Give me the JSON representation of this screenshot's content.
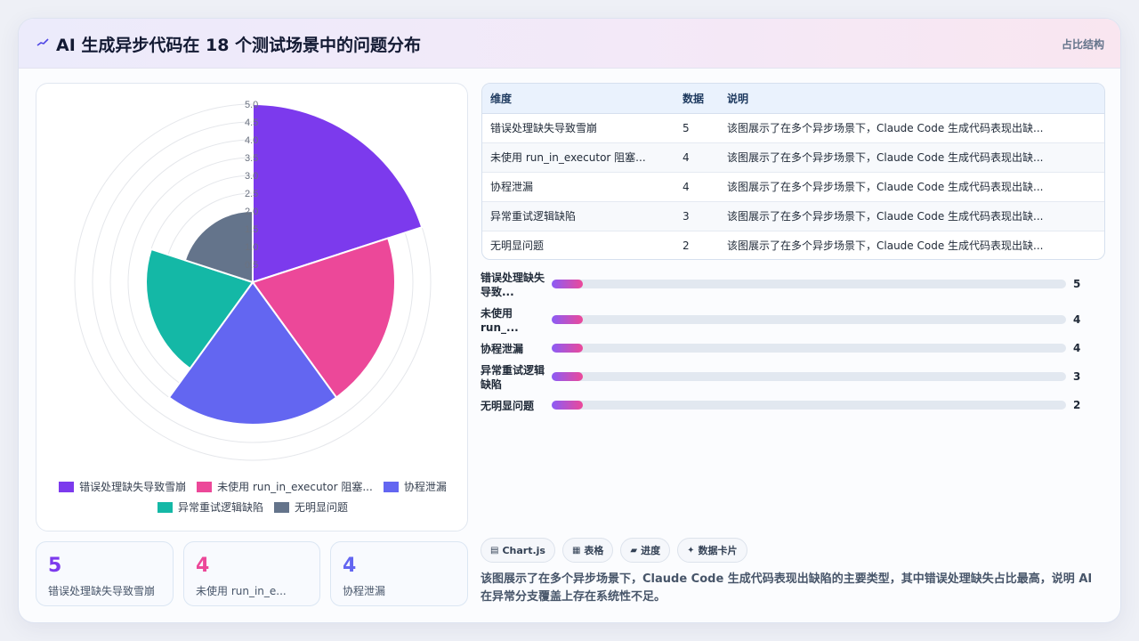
{
  "header": {
    "title": "AI 生成异步代码在 18 个测试场景中的问题分布",
    "subtitle": "占比结构",
    "icon": "trend-line-icon"
  },
  "chart_data": {
    "type": "polarArea",
    "categories": [
      "错误处理缺失导致雪崩",
      "未使用 run_in_executor 阻塞...",
      "协程泄漏",
      "异常重试逻辑缺陷",
      "无明显问题"
    ],
    "values": [
      5,
      4,
      4,
      3,
      2
    ],
    "colors": [
      "#7c3aed",
      "#ec4899",
      "#6366f1",
      "#14b8a6",
      "#64748b"
    ],
    "r_max": 5.0,
    "r_ticks": [
      "5.0",
      "4.5",
      "4.0",
      "3.5",
      "3.0",
      "2.5",
      "2.0",
      "1.5",
      "1.0",
      "0.5"
    ],
    "legend_position": "bottom"
  },
  "table": {
    "headers": [
      "维度",
      "数据",
      "说明"
    ],
    "rows": [
      [
        "错误处理缺失导致雪崩",
        "5",
        "该图展示了在多个异步场景下，Claude Code 生成代码表现出缺..."
      ],
      [
        "未使用 run_in_executor 阻塞...",
        "4",
        "该图展示了在多个异步场景下，Claude Code 生成代码表现出缺..."
      ],
      [
        "协程泄漏",
        "4",
        "该图展示了在多个异步场景下，Claude Code 生成代码表现出缺..."
      ],
      [
        "异常重试逻辑缺陷",
        "3",
        "该图展示了在多个异步场景下，Claude Code 生成代码表现出缺..."
      ],
      [
        "无明显问题",
        "2",
        "该图展示了在多个异步场景下，Claude Code 生成代码表现出缺..."
      ]
    ]
  },
  "bars": [
    {
      "label_line1": "错误处理缺失",
      "label_line2": "导致...",
      "value": "5",
      "fill_fraction": 0.06
    },
    {
      "label_line1": "未使用",
      "label_line2": "run_...",
      "value": "4",
      "fill_fraction": 0.06
    },
    {
      "label_line1": "协程泄漏",
      "label_line2": "",
      "value": "4",
      "fill_fraction": 0.06
    },
    {
      "label_line1": "异常重试逻辑",
      "label_line2": "缺陷",
      "value": "3",
      "fill_fraction": 0.06
    },
    {
      "label_line1": "无明显问题",
      "label_line2": "",
      "value": "2",
      "fill_fraction": 0.06
    }
  ],
  "stat_cards": [
    {
      "value": "5",
      "label": "错误处理缺失导致雪崩",
      "color": "#7c3aed"
    },
    {
      "value": "4",
      "label": "未使用 run_in_e...",
      "color": "#ec4899"
    },
    {
      "value": "4",
      "label": "协程泄漏",
      "color": "#6366f1"
    }
  ],
  "chips": [
    {
      "icon": "▤",
      "label": "Chart.js"
    },
    {
      "icon": "▦",
      "label": "表格"
    },
    {
      "icon": "▰",
      "label": "进度"
    },
    {
      "icon": "✦",
      "label": "数据卡片"
    }
  ],
  "summary": "该图展示了在多个异步场景下，Claude Code 生成代码表现出缺陷的主要类型，其中错误处理缺失占比最高，说明 AI 在异常分支覆盖上存在系统性不足。"
}
